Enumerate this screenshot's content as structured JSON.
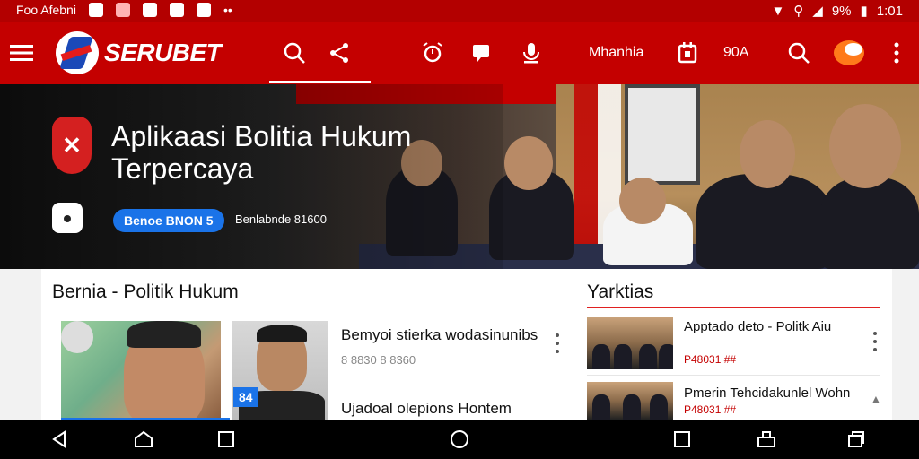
{
  "status_bar": {
    "left_text": "Foo Afebni",
    "battery": "9%",
    "time": "1:01"
  },
  "app_bar": {
    "brand": "SERUBET",
    "menu_label": "Mhanhia",
    "right_label": "90A"
  },
  "hero": {
    "title": "Aplikaasi   Bolitia Hukum Terpercaya",
    "badge": "Benoe BNON 5",
    "note": "Benlabnde 81600"
  },
  "main": {
    "section_title": "Bernia - Politik Hukum",
    "thumb_tag": "84",
    "articles": [
      {
        "title": "Bemyoi stierka wodasinunibs",
        "meta": "8 8830  8 8360"
      },
      {
        "title": "Ujadoal olepions Hontem"
      }
    ]
  },
  "sidebar": {
    "title": "Yarktias",
    "items": [
      {
        "title": "Apptado deto - Politk Aiu",
        "meta": "P48031 ##"
      },
      {
        "title": "Pmerin Tehcidakunlel Wohn",
        "meta": "P48031 ##"
      }
    ]
  },
  "colors": {
    "brand_red": "#c40000",
    "accent_blue": "#1a73e8"
  }
}
